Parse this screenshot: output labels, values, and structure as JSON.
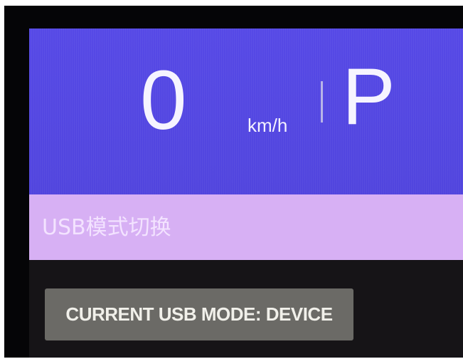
{
  "header": {
    "speed": "0",
    "speed_unit": "km/h",
    "gear": "P"
  },
  "title_bar": {
    "title": "USB模式切换"
  },
  "main": {
    "mode_button_label": "CURRENT USB MODE: DEVICE"
  },
  "colors": {
    "header_background": "#5548e4",
    "title_bar_background": "#d7b0f4",
    "content_background": "#161417",
    "button_background": "#6b6a66"
  }
}
